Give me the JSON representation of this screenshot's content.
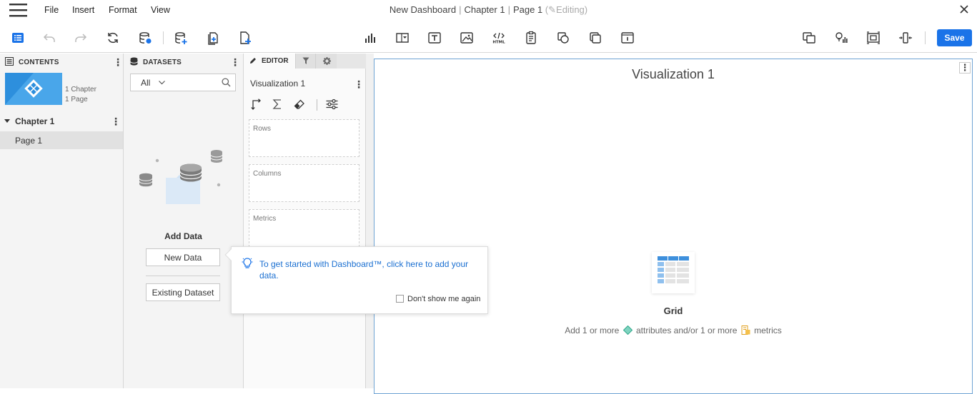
{
  "menu": {
    "file": "File",
    "insert": "Insert",
    "format": "Format",
    "view": "View"
  },
  "title": {
    "dashboard": "New Dashboard",
    "chapter": "Chapter 1",
    "page": "Page 1",
    "status": "Editing"
  },
  "toolbar": {
    "save_label": "Save",
    "accent_color": "#1a73e8"
  },
  "contents": {
    "header": "CONTENTS",
    "chapter_count": "1 Chapter",
    "page_count": "1 Page",
    "chapter": "Chapter 1",
    "page": "Page 1"
  },
  "datasets": {
    "header": "DATASETS",
    "filter_value": "All",
    "add_data_title": "Add Data",
    "new_data_button": "New Data",
    "existing_dataset_button": "Existing Dataset"
  },
  "editor": {
    "tabs": {
      "editor": "EDITOR"
    },
    "viz_name": "Visualization 1",
    "zones": {
      "rows": "Rows",
      "columns": "Columns",
      "metrics": "Metrics"
    }
  },
  "canvas": {
    "viz_title": "Visualization 1",
    "grid_label": "Grid",
    "hint": {
      "part1": "Add 1 or more",
      "attributes": "attributes and/or 1 or more",
      "metrics": "metrics"
    }
  },
  "tooltip": {
    "message": "To get started with Dashboard™, click here to add your data.",
    "dont_show": "Don't show me again"
  }
}
